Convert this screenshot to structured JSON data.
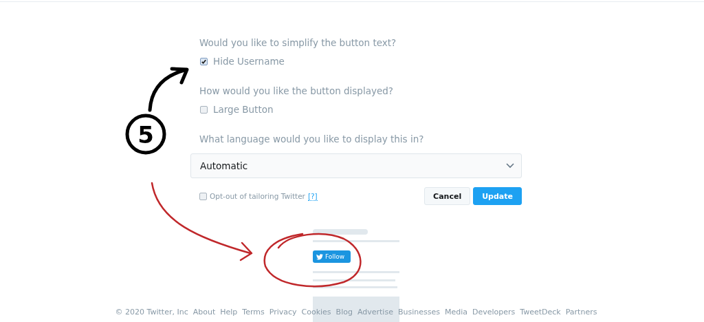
{
  "questions": [
    {
      "prompt": "Would you like to simplify the button text?",
      "option": {
        "label": "Hide Username",
        "checked": true
      }
    },
    {
      "prompt": "How would you like the button displayed?",
      "option": {
        "label": "Large Button",
        "checked": false
      }
    }
  ],
  "language": {
    "prompt": "What language would you like to display this in?",
    "value": "Automatic"
  },
  "opt_out": {
    "label": "Opt-out of tailoring Twitter",
    "help": "[?]",
    "checked": false
  },
  "buttons": [
    {
      "label": "Cancel",
      "kind": "secondary"
    },
    {
      "label": "Update",
      "kind": "primary"
    }
  ],
  "preview": {
    "follow_button": "Follow"
  },
  "footer": {
    "copyright": "© 2020 Twitter, Inc",
    "links": [
      "About",
      "Help",
      "Terms",
      "Privacy",
      "Cookies",
      "Blog",
      "Advertise",
      "Businesses",
      "Media",
      "Developers",
      "TweetDeck",
      "Partners"
    ]
  },
  "annotation": {
    "number": "5"
  }
}
